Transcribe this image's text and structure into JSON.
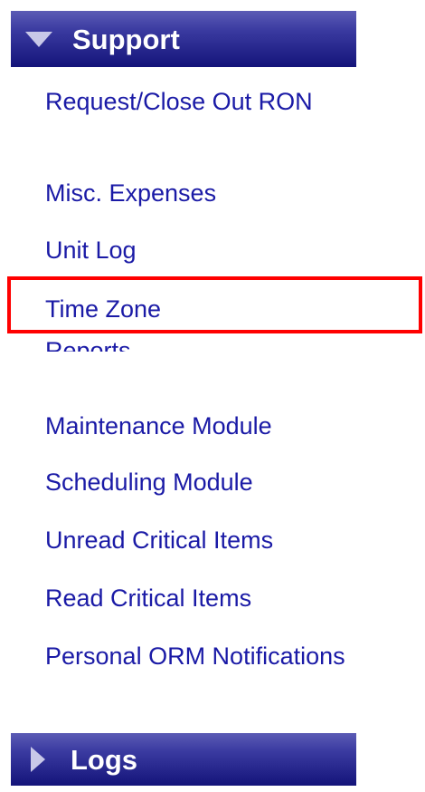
{
  "sections": {
    "support": {
      "label": "Support",
      "icon": "triangle-down-icon"
    },
    "logs": {
      "label": "Logs",
      "icon": "triangle-right-icon"
    }
  },
  "menu": {
    "items": [
      {
        "label": "Request/Close Out RON"
      },
      {
        "label": "Misc. Expenses"
      },
      {
        "label": "Unit Log"
      },
      {
        "label": "Time Zone"
      },
      {
        "label": "Reports"
      },
      {
        "label": "Maintenance Module"
      },
      {
        "label": "Scheduling Module"
      },
      {
        "label": "Unread Critical Items"
      },
      {
        "label": "Read Critical Items"
      },
      {
        "label": "Personal ORM Notifications"
      }
    ]
  },
  "colors": {
    "header_gradient_top": "#5b5bb5",
    "header_gradient_bottom": "#14147a",
    "link": "#1a1aa6",
    "highlight": "#ff0000"
  }
}
